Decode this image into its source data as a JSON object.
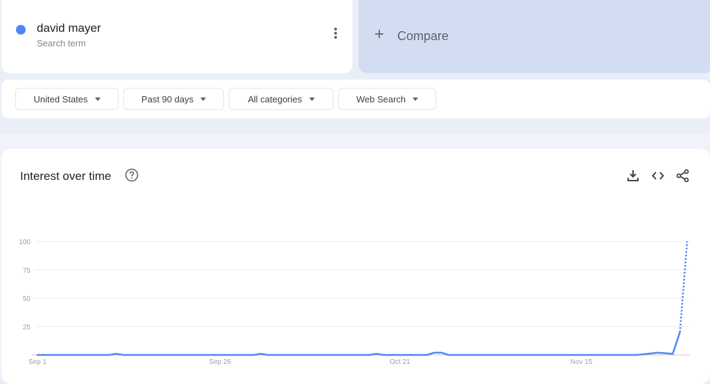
{
  "search_term": {
    "name": "david mayer",
    "subtitle": "Search term",
    "color": "#4f86f7",
    "more_icon": "more-vert-icon"
  },
  "compare": {
    "label": "Compare",
    "icon": "plus-icon"
  },
  "filters": [
    {
      "label": "United States"
    },
    {
      "label": "Past 90 days"
    },
    {
      "label": "All categories"
    },
    {
      "label": "Web Search"
    }
  ],
  "panel": {
    "title": "Interest over time",
    "help_icon": "help-icon",
    "tools": [
      "download-icon",
      "embed-code-icon",
      "share-icon"
    ]
  },
  "chart_data": {
    "type": "line",
    "title": "Interest over time",
    "xlabel": "",
    "ylabel": "",
    "ylim": [
      0,
      100
    ],
    "yticks": [
      25,
      50,
      75,
      100
    ],
    "xtick_labels": [
      {
        "day": 0,
        "label": "Sep 1"
      },
      {
        "day": 25,
        "label": "Sep 26"
      },
      {
        "day": 50,
        "label": "Oct 21"
      },
      {
        "day": 75,
        "label": "Nov 15"
      }
    ],
    "x_range_days": [
      0,
      90
    ],
    "grid": true,
    "series": [
      {
        "name": "david mayer",
        "color": "#4f86f7",
        "points": [
          [
            0,
            0
          ],
          [
            10,
            0
          ],
          [
            11,
            1
          ],
          [
            12,
            0
          ],
          [
            30,
            0
          ],
          [
            31,
            1
          ],
          [
            32,
            0
          ],
          [
            46,
            0
          ],
          [
            47,
            1
          ],
          [
            48,
            0
          ],
          [
            54,
            0
          ],
          [
            55,
            2
          ],
          [
            56,
            2
          ],
          [
            57,
            0
          ],
          [
            83,
            0
          ],
          [
            86,
            2
          ],
          [
            88,
            1
          ],
          [
            89,
            20
          ]
        ],
        "partial_points": [
          [
            89,
            20
          ],
          [
            90,
            100
          ]
        ]
      }
    ]
  }
}
